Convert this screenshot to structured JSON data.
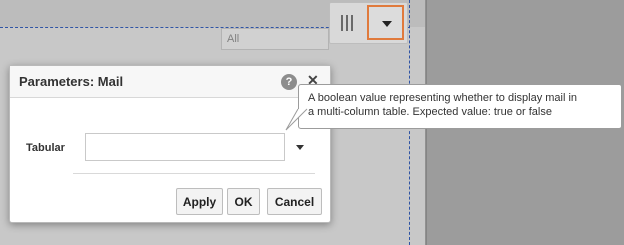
{
  "workspace": {
    "filter_select": "All"
  },
  "toolbar": {
    "columns_icon": "columns-icon",
    "menu_icon": "caret-down-icon",
    "accent_color": "#e07a3c"
  },
  "dialog": {
    "title": "Parameters: Mail",
    "help_icon": "help-icon",
    "help_glyph": "?",
    "close_icon": "close-icon",
    "close_glyph": "✕",
    "field_label": "Tabular",
    "field_value": "",
    "dropdown_icon": "caret-down-icon",
    "apply_label": "Apply",
    "ok_label": "OK",
    "cancel_label": "Cancel"
  },
  "tooltip": {
    "line1": "A boolean value representing whether to display mail in",
    "line2": "a multi-column table. Expected value: true or false"
  }
}
